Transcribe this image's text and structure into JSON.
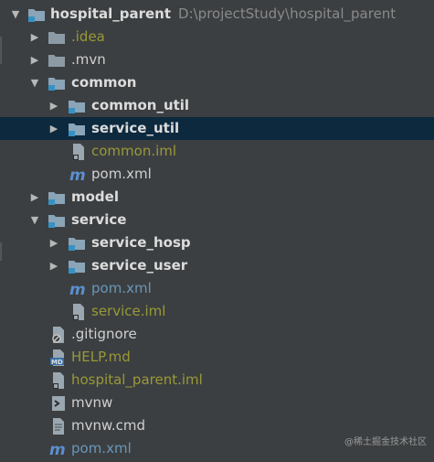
{
  "project": {
    "root": {
      "name": "hospital_parent",
      "path": "D:\\projectStudy\\hospital_parent"
    },
    "items": [
      {
        "label": ".idea"
      },
      {
        "label": ".mvn"
      },
      {
        "label": "common"
      },
      {
        "label": "common_util"
      },
      {
        "label": "service_util"
      },
      {
        "label": "common.iml"
      },
      {
        "label": "pom.xml"
      },
      {
        "label": "model"
      },
      {
        "label": "service"
      },
      {
        "label": "service_hosp"
      },
      {
        "label": "service_user"
      },
      {
        "label": "pom.xml"
      },
      {
        "label": "service.iml"
      },
      {
        "label": ".gitignore"
      },
      {
        "label": "HELP.md"
      },
      {
        "label": "hospital_parent.iml"
      },
      {
        "label": "mvnw"
      },
      {
        "label": "mvnw.cmd"
      },
      {
        "label": "pom.xml"
      }
    ],
    "selected_item": "service_util"
  },
  "icons": {
    "folder": "folder-icon",
    "module": "module-folder-icon",
    "maven": "maven-pom-icon",
    "iml": "iml-file-icon",
    "ignore": "gitignore-file-icon",
    "markdown": "markdown-file-icon",
    "script": "shell-script-icon",
    "text": "text-file-icon"
  },
  "colors": {
    "background": "#3c3f41",
    "selection": "#0d293e",
    "text": "#d0d0d0",
    "ignored_text": "#999937",
    "vcs_added_text": "#6897bb"
  },
  "watermark": "@稀土掘金技术社区"
}
